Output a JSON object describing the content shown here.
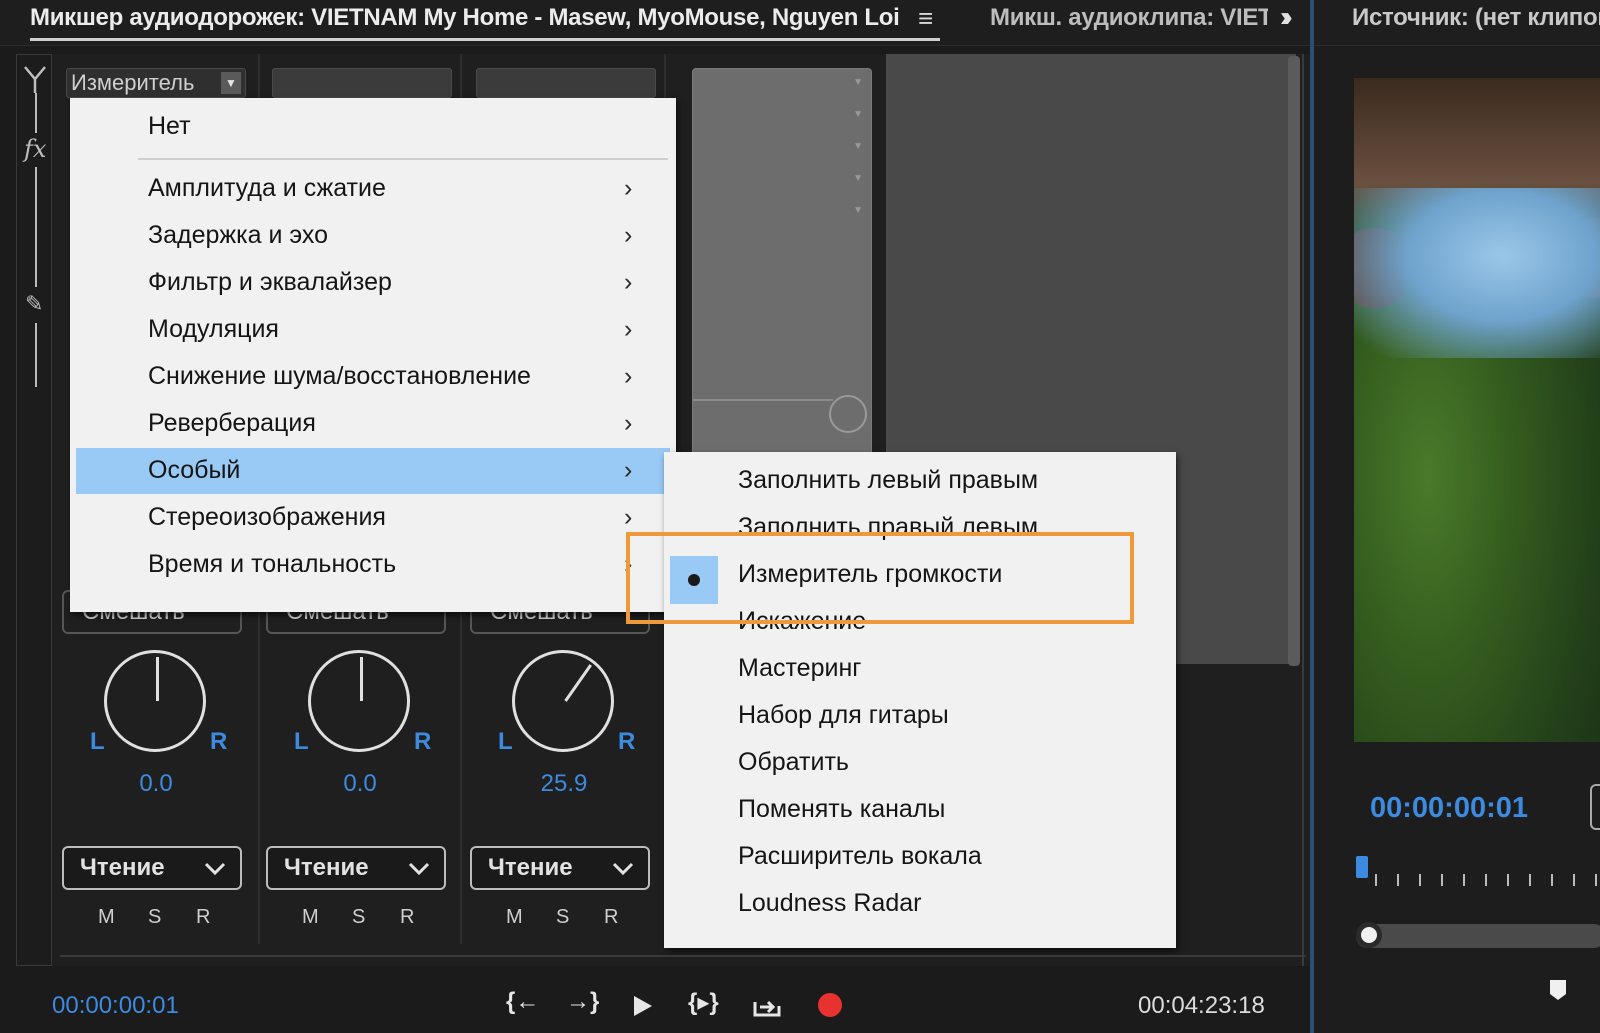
{
  "tabs": {
    "audio_track_mixer": "Микшер аудиодорожек: VIETNAM   My Home - Masew, MyoMouse, Nguyen Loi",
    "panel_menu_icon": "hamburger-icon",
    "audio_clip_mixer": "Микш. аудиоклипа: VIETNAM",
    "overflow_icon": "double-chevron-right-icon",
    "source": "Источник: (нет клипов)"
  },
  "mixer": {
    "fx_label": "fx",
    "tracks": [
      {
        "effect_slot": "Измеритель",
        "mix_dropdown": "Смешать",
        "pan_value": "0.0",
        "pan_left": "L",
        "pan_right": "R",
        "automation": "Чтение",
        "mute": "M",
        "solo": "S",
        "record": "R"
      },
      {
        "effect_slot": "",
        "mix_dropdown": "Смешать",
        "pan_value": "0.0",
        "pan_left": "L",
        "pan_right": "R",
        "automation": "Чтение",
        "mute": "M",
        "solo": "S",
        "record": "R"
      },
      {
        "effect_slot": "",
        "mix_dropdown": "Смешать",
        "pan_value": "25.9",
        "pan_left": "L",
        "pan_right": "R",
        "automation": "Чтение",
        "mute": "M",
        "solo": "S",
        "record": "R"
      }
    ],
    "timecode_current": "00:00:00:01",
    "timecode_duration": "00:04:23:18",
    "transport": {
      "go_to_in": "go-to-in-point-icon",
      "go_to_out": "go-to-out-point-icon",
      "play": "play-icon",
      "play_in_to_out": "play-in-to-out-icon",
      "loop": "loop-icon",
      "record": "record-icon",
      "record_color": "#e8322f"
    }
  },
  "effects_menu": {
    "items": [
      {
        "label": "Нет",
        "has_submenu": false
      },
      {
        "label": "Амплитуда и сжатие",
        "has_submenu": true
      },
      {
        "label": "Задержка и эхо",
        "has_submenu": true
      },
      {
        "label": "Фильтр и эквалайзер",
        "has_submenu": true
      },
      {
        "label": "Модуляция",
        "has_submenu": true
      },
      {
        "label": "Снижение шума/восстановление",
        "has_submenu": true
      },
      {
        "label": "Реверберация",
        "has_submenu": true
      },
      {
        "label": "Особый",
        "has_submenu": true,
        "highlighted": true
      },
      {
        "label": "Стереоизображения",
        "has_submenu": true
      },
      {
        "label": "Время и тональность",
        "has_submenu": true
      }
    ],
    "arrow_glyph": "›"
  },
  "special_submenu": {
    "items": [
      {
        "label": "Заполнить левый правым"
      },
      {
        "label": "Заполнить правый левым"
      },
      {
        "label": "Измеритель громкости",
        "checked": true
      },
      {
        "label": "Искажение"
      },
      {
        "label": "Мастеринг"
      },
      {
        "label": "Набор для гитары"
      },
      {
        "label": "Обратить"
      },
      {
        "label": "Поменять каналы"
      },
      {
        "label": "Расширитель вокала"
      },
      {
        "label": "Loudness Radar"
      }
    ],
    "highlight_color": "#ee9a3a"
  },
  "source_monitor": {
    "timecode": "00:00:00:01"
  },
  "colors": {
    "accent_blue": "#3d8be0",
    "menu_highlight": "#99c9f5",
    "annotation_orange": "#ee9a3a"
  }
}
